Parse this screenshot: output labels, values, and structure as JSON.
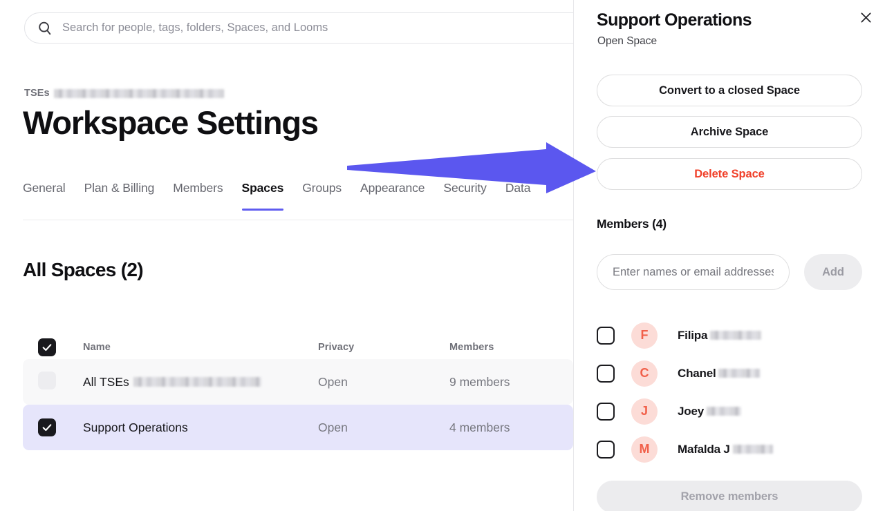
{
  "search": {
    "placeholder": "Search for people, tags, folders, Spaces, and Looms",
    "value": "",
    "icon": "search-icon"
  },
  "header": {
    "breadcrumb_prefix": "TSEs",
    "breadcrumb_redacted": true,
    "title": "Workspace Settings"
  },
  "tabs": [
    {
      "label": "General",
      "active": false
    },
    {
      "label": "Plan & Billing",
      "active": false
    },
    {
      "label": "Members",
      "active": false
    },
    {
      "label": "Spaces",
      "active": true
    },
    {
      "label": "Groups",
      "active": false
    },
    {
      "label": "Appearance",
      "active": false
    },
    {
      "label": "Security",
      "active": false
    },
    {
      "label": "Data",
      "active": false
    }
  ],
  "spaces_section": {
    "heading": "All Spaces (2)",
    "columns": {
      "name": "Name",
      "privacy": "Privacy",
      "members": "Members"
    },
    "select_all_checked": true,
    "rows": [
      {
        "name": "All TSEs",
        "name_redacted": true,
        "privacy": "Open",
        "members": "9 members",
        "checked": false,
        "selected": false
      },
      {
        "name": "Support Operations",
        "name_redacted": false,
        "privacy": "Open",
        "members": "4 members",
        "checked": true,
        "selected": true
      }
    ]
  },
  "panel": {
    "title": "Support Operations",
    "subtitle": "Open Space",
    "close_icon": "close-icon",
    "actions": [
      {
        "label": "Convert to a closed Space",
        "danger": false
      },
      {
        "label": "Archive Space",
        "danger": false
      },
      {
        "label": "Delete Space",
        "danger": true
      }
    ],
    "members_heading": "Members (4)",
    "add_input_placeholder": "Enter names or email addresses",
    "add_input_value": "",
    "add_button_label": "Add",
    "members": [
      {
        "initial": "F",
        "name": "Filipa",
        "redacted": true,
        "checked": false
      },
      {
        "initial": "C",
        "name": "Chanel",
        "redacted": true,
        "checked": false
      },
      {
        "initial": "J",
        "name": "Joey",
        "redacted": true,
        "checked": false
      },
      {
        "initial": "M",
        "name": "Mafalda J",
        "redacted": true,
        "checked": false
      }
    ],
    "remove_button_label": "Remove members"
  },
  "annotation": {
    "type": "arrow",
    "color": "#5b57ef",
    "points_to": "Delete Space"
  },
  "colors": {
    "accent": "#5f5cf0",
    "danger": "#f0402a",
    "selected_row": "#e6e5fb",
    "avatar_bg": "#fcdcd7",
    "avatar_fg": "#f1604a"
  }
}
